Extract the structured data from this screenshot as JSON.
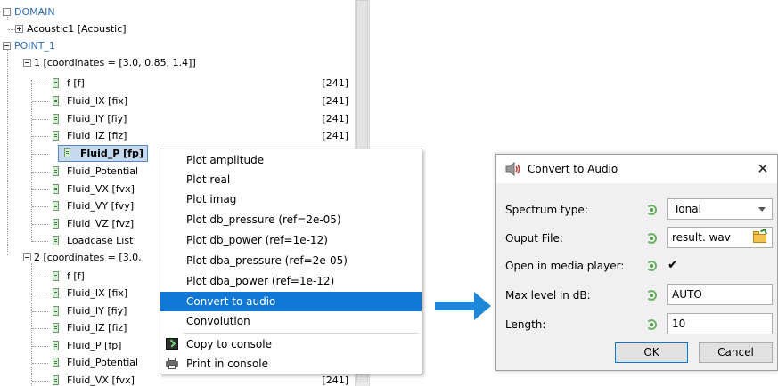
{
  "tree": {
    "rows": [
      {
        "label": "DOMAIN",
        "value": "",
        "style": "blue",
        "expander": "minus"
      },
      {
        "label": "Acoustic1 [Acoustic]",
        "value": "",
        "style": "",
        "expander": "plus"
      },
      {
        "label": "POINT_1",
        "value": "",
        "style": "blue",
        "expander": "minus"
      },
      {
        "label": "1 [coordinates = [3.0, 0.85, 1.4]]",
        "value": "",
        "style": "",
        "expander": "minus"
      },
      {
        "label": "f  [f]",
        "value": "[241]",
        "style": "leaf"
      },
      {
        "label": "Fluid_IX  [fix]",
        "value": "[241]",
        "style": "leaf"
      },
      {
        "label": "Fluid_IY  [fiy]",
        "value": "[241]",
        "style": "leaf"
      },
      {
        "label": "Fluid_IZ  [fiz]",
        "value": "[241]",
        "style": "leaf"
      },
      {
        "label": "Fluid_P  [fp]",
        "value": "",
        "style": "leaf-selected"
      },
      {
        "label": "Fluid_Potential",
        "value": "",
        "style": "leaf"
      },
      {
        "label": "Fluid_VX  [fvx]",
        "value": "",
        "style": "leaf"
      },
      {
        "label": "Fluid_VY  [fvy]",
        "value": "",
        "style": "leaf"
      },
      {
        "label": "Fluid_VZ  [fvz]",
        "value": "",
        "style": "leaf"
      },
      {
        "label": "Loadcase List",
        "value": "",
        "style": "leaf"
      },
      {
        "label": "2 [coordinates = [3.0,",
        "value": "",
        "style": "",
        "expander": "minus"
      },
      {
        "label": "f  [f]",
        "value": "",
        "style": "leaf"
      },
      {
        "label": "Fluid_IX  [fix]",
        "value": "",
        "style": "leaf"
      },
      {
        "label": "Fluid_IY  [fiy]",
        "value": "",
        "style": "leaf"
      },
      {
        "label": "Fluid_IZ  [fiz]",
        "value": "",
        "style": "leaf"
      },
      {
        "label": "Fluid_P  [fp]",
        "value": "",
        "style": "leaf"
      },
      {
        "label": "Fluid_Potential",
        "value": "",
        "style": "leaf"
      },
      {
        "label": "Fluid_VX  [fvx]",
        "value": "[241]",
        "style": "leaf"
      }
    ]
  },
  "context_menu": {
    "items": [
      "Plot amplitude",
      "Plot real",
      "Plot imag",
      "Plot db_pressure (ref=2e-05)",
      "Plot db_power (ref=1e-12)",
      "Plot dba_pressure (ref=2e-05)",
      "Plot dba_power (ref=1e-12)",
      "Convert to audio",
      "Convolution",
      "Copy to console",
      "Print in console"
    ],
    "active_item": "Convert to audio",
    "icons": {
      "Copy to console": "terminal-icon",
      "Print in console": "printer-icon"
    }
  },
  "dialog": {
    "title": "Convert to Audio",
    "close_glyph": "✕",
    "fields": {
      "spectrum_type": {
        "label": "Spectrum type:",
        "value": "Tonal"
      },
      "output_file": {
        "label": "Ouput File:",
        "value": "result. wav"
      },
      "open_media_player": {
        "label": "Open in media player:",
        "checked_glyph": "✔"
      },
      "max_level": {
        "label": "Max level in dB:",
        "value": "AUTO"
      },
      "length": {
        "label": "Length:",
        "value": "10"
      }
    },
    "ok_label": "OK",
    "cancel_label": "Cancel"
  },
  "colors": {
    "menu_highlight": "#0f78d7",
    "arrow": "#1f88d6",
    "tree_accent": "#2a6db5",
    "selection_fill": "#c5d9ef"
  }
}
